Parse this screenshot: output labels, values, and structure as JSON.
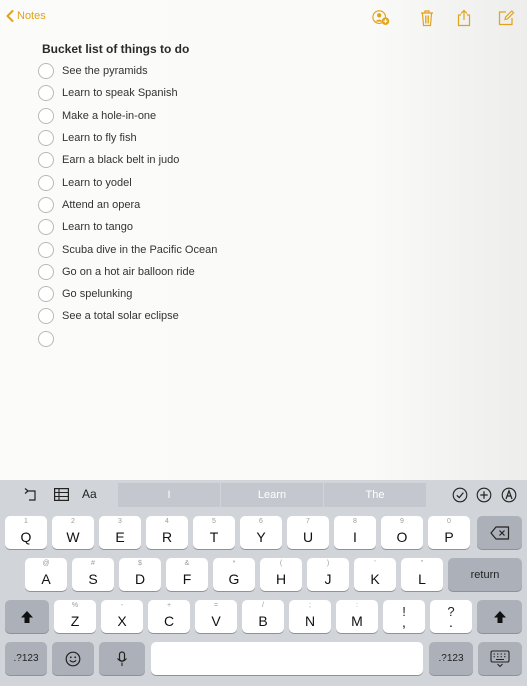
{
  "nav": {
    "back_label": "Notes",
    "icons": [
      "add-people-icon",
      "trash-icon",
      "share-icon",
      "compose-icon"
    ],
    "accent": "#e2a21a"
  },
  "note": {
    "title": "Bucket list of things to do",
    "items": [
      "See the pyramids",
      "Learn to speak Spanish",
      "Make a hole-in-one",
      "Learn to fly fish",
      "Earn a black belt in judo",
      "Learn to yodel",
      "Attend an opera",
      "Learn to tango",
      "Scuba dive in the Pacific Ocean",
      "Go on a hot air balloon ride",
      "Go spelunking",
      "See a total solar eclipse",
      ""
    ]
  },
  "keyboard": {
    "toolbar": {
      "format_label": "Aa"
    },
    "suggestions": [
      "I",
      "Learn",
      "The"
    ],
    "row1": [
      {
        "alt": "1",
        "key": "Q"
      },
      {
        "alt": "2",
        "key": "W"
      },
      {
        "alt": "3",
        "key": "E"
      },
      {
        "alt": "4",
        "key": "R"
      },
      {
        "alt": "5",
        "key": "T"
      },
      {
        "alt": "6",
        "key": "Y"
      },
      {
        "alt": "7",
        "key": "U"
      },
      {
        "alt": "8",
        "key": "I"
      },
      {
        "alt": "9",
        "key": "O"
      },
      {
        "alt": "0",
        "key": "P"
      }
    ],
    "row2": [
      {
        "alt": "@",
        "key": "A"
      },
      {
        "alt": "#",
        "key": "S"
      },
      {
        "alt": "$",
        "key": "D"
      },
      {
        "alt": "&",
        "key": "F"
      },
      {
        "alt": "*",
        "key": "G"
      },
      {
        "alt": "(",
        "key": "H"
      },
      {
        "alt": ")",
        "key": "J"
      },
      {
        "alt": "'",
        "key": "K"
      },
      {
        "alt": "\"",
        "key": "L"
      }
    ],
    "row3": [
      {
        "alt": "%",
        "key": "Z"
      },
      {
        "alt": "-",
        "key": "X"
      },
      {
        "alt": "+",
        "key": "C"
      },
      {
        "alt": "=",
        "key": "V"
      },
      {
        "alt": "/",
        "key": "B"
      },
      {
        "alt": ";",
        "key": "N"
      },
      {
        "alt": ":",
        "key": "M"
      },
      {
        "alt": "!",
        "key": ","
      },
      {
        "alt": "?",
        "key": "."
      }
    ],
    "return_label": "return",
    "numbers_label": ".?123"
  }
}
